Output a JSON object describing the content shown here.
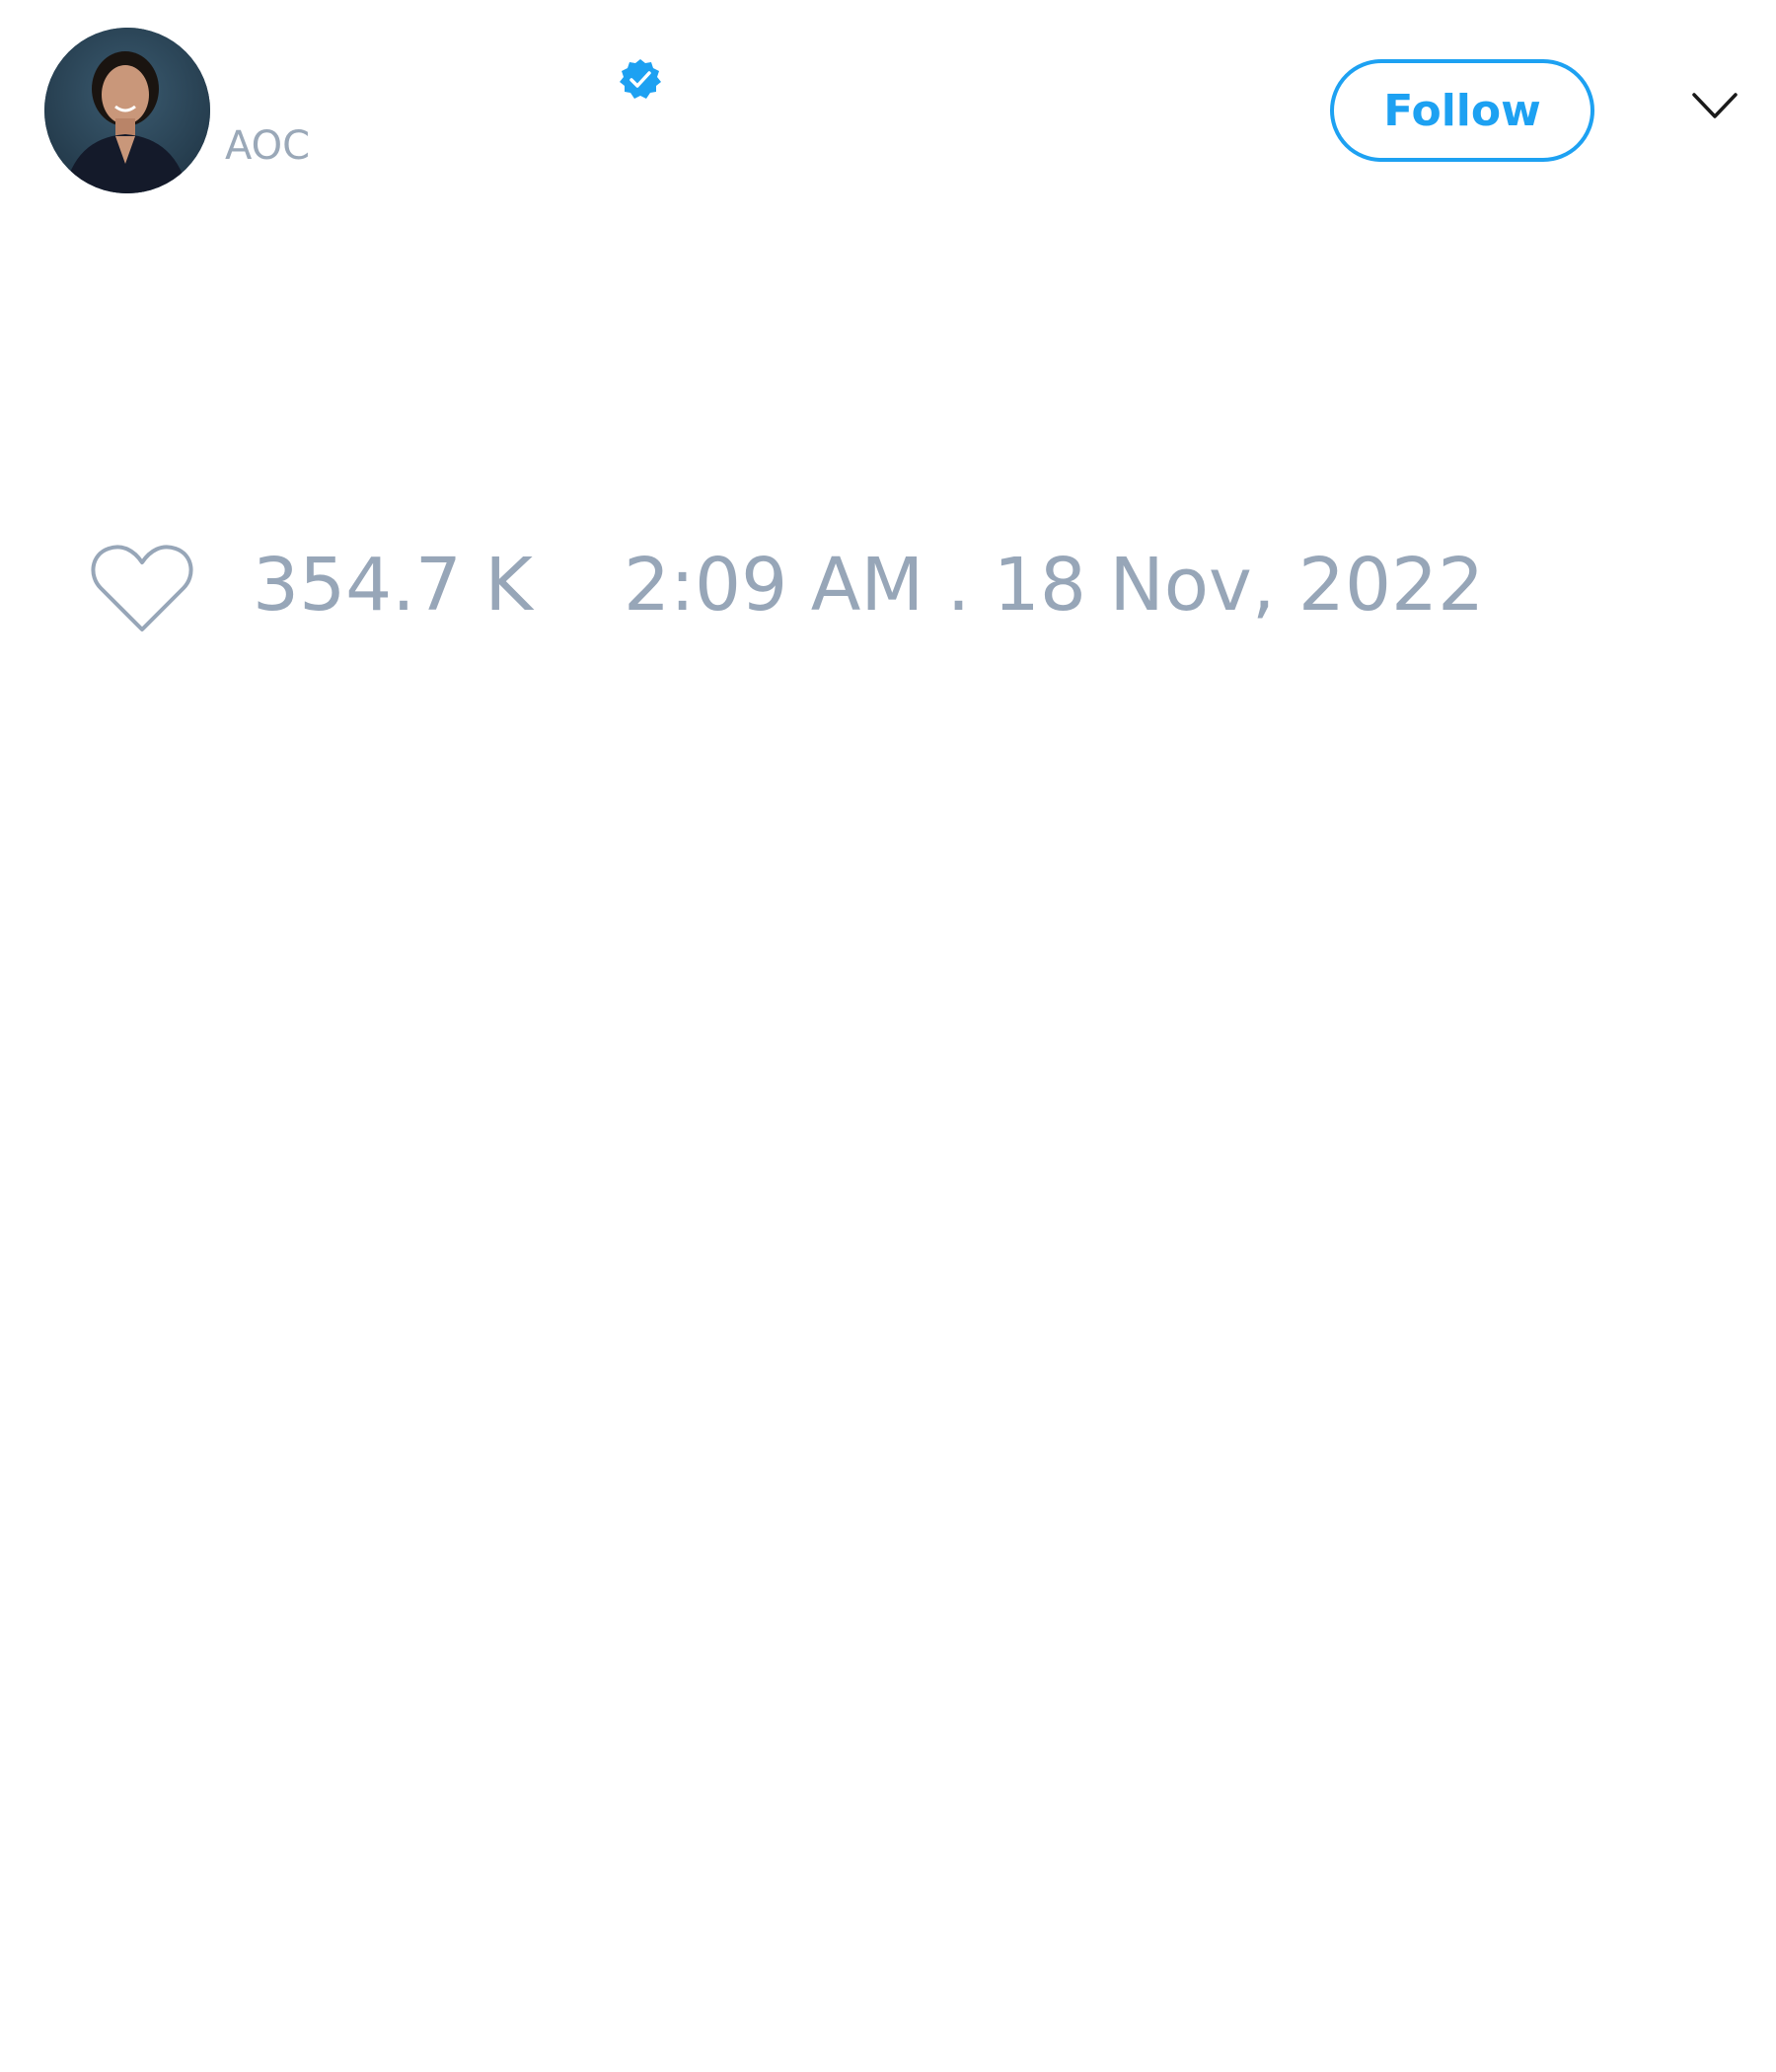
{
  "tweet": {
    "author": {
      "avatar_icon": "profile-photo",
      "verified_icon": "verified-badge-icon",
      "handle": "AOC"
    },
    "actions": {
      "follow_label": "Follow",
      "menu_icon": "chevron-down-icon"
    },
    "footer": {
      "like_icon": "heart-outline-icon",
      "like_count": "354.7 K",
      "timestamp": "2:09 AM . 18 Nov, 2022"
    }
  },
  "colors": {
    "accent": "#1da1f2",
    "muted_text": "#97a6b8",
    "background": "#ffffff"
  }
}
